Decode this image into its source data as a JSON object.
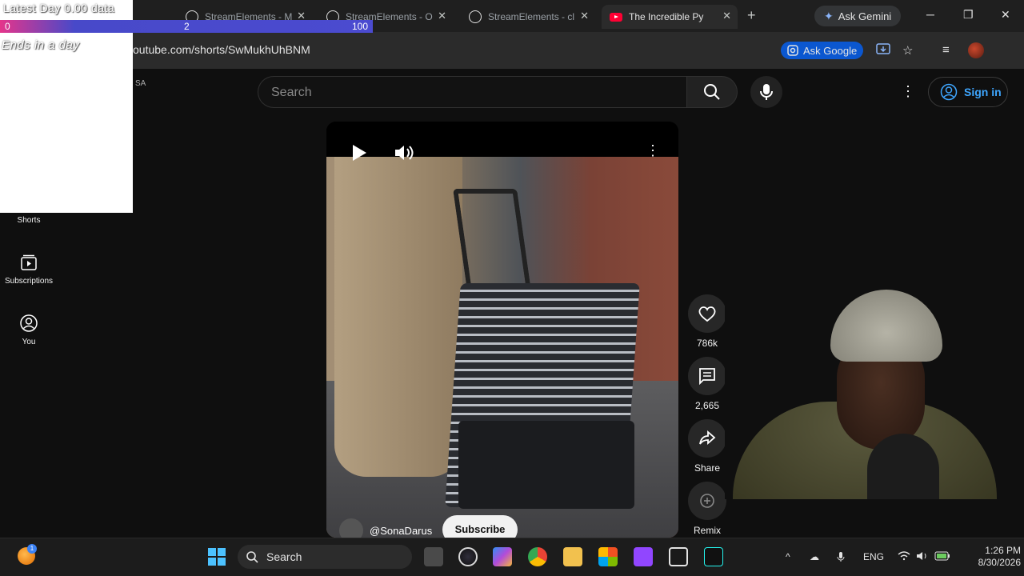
{
  "browser": {
    "tabs": [
      {
        "label": "StreamElements - M"
      },
      {
        "label": "StreamElements - O"
      },
      {
        "label": "StreamElements - cl"
      },
      {
        "label": "The Incredible Py"
      }
    ],
    "new_tab": "+",
    "gemini_label": "Ask Gemini",
    "url": "outube.com/shorts/SwMukhUhBNM",
    "ask_google_label": "Ask Google"
  },
  "overlay": {
    "title": "Latest Day 0.00 data",
    "bar_labels": [
      "0",
      "2",
      "100"
    ],
    "ends_text": "Ends in a day"
  },
  "youtube": {
    "region_badge": "SA",
    "search_placeholder": "Search",
    "sign_in": "Sign in",
    "nav": [
      {
        "label": "Shorts"
      },
      {
        "label": "Subscriptions"
      },
      {
        "label": "You"
      }
    ],
    "video": {
      "channel": "@SonaDarus",
      "subscribe": "Subscribe"
    },
    "actions": {
      "likes": "786k",
      "comments": "2,665",
      "share": "Share",
      "remix": "Remix"
    }
  },
  "taskbar": {
    "search_label": "Search",
    "notification_count": "1",
    "language": "ENG",
    "time": "1:26 PM",
    "date": "8/30/2026"
  },
  "colors": {
    "accent_blue": "#3ea6ff",
    "youtube_red": "#ff0033",
    "bar_pink": "#e4358b",
    "bar_blue": "#4b4bd0"
  }
}
